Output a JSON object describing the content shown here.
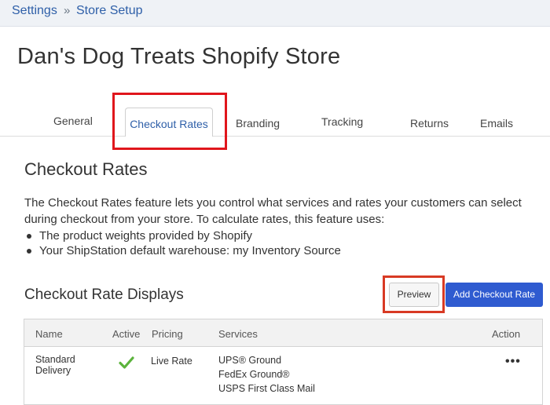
{
  "breadcrumb": {
    "items": [
      "Settings",
      "Store Setup"
    ],
    "separator": "»"
  },
  "page": {
    "title": "Dan's Dog Treats Shopify Store"
  },
  "tabs": {
    "general": "General",
    "checkout_rates": "Checkout Rates",
    "branding": "Branding",
    "tracking": "Tracking",
    "returns": "Returns",
    "emails": "Emails",
    "active": "Checkout Rates"
  },
  "checkout": {
    "title": "Checkout Rates",
    "description": "The Checkout Rates feature lets you control what services and rates your customers can select during checkout from your store. To calculate rates, this feature uses:",
    "bullets": [
      "The product weights provided by Shopify",
      "Your ShipStation default warehouse: my Inventory Source"
    ]
  },
  "displays": {
    "title": "Checkout Rate Displays",
    "preview_label": "Preview",
    "add_label": "Add Checkout Rate"
  },
  "table": {
    "headers": {
      "name": "Name",
      "active": "Active",
      "pricing": "Pricing",
      "services": "Services",
      "action": "Action"
    },
    "rows": [
      {
        "name_line1": "Standard",
        "name_line2": "Delivery",
        "active": true,
        "pricing": "Live Rate",
        "services": [
          "UPS® Ground",
          "FedEx Ground®",
          "USPS First Class Mail"
        ],
        "action_icon": "more-dots-icon"
      }
    ]
  },
  "colors": {
    "link": "#2e5fa8",
    "primary_button": "#2f5bd0",
    "highlight": "#e0161c",
    "check": "#5bb33c"
  }
}
